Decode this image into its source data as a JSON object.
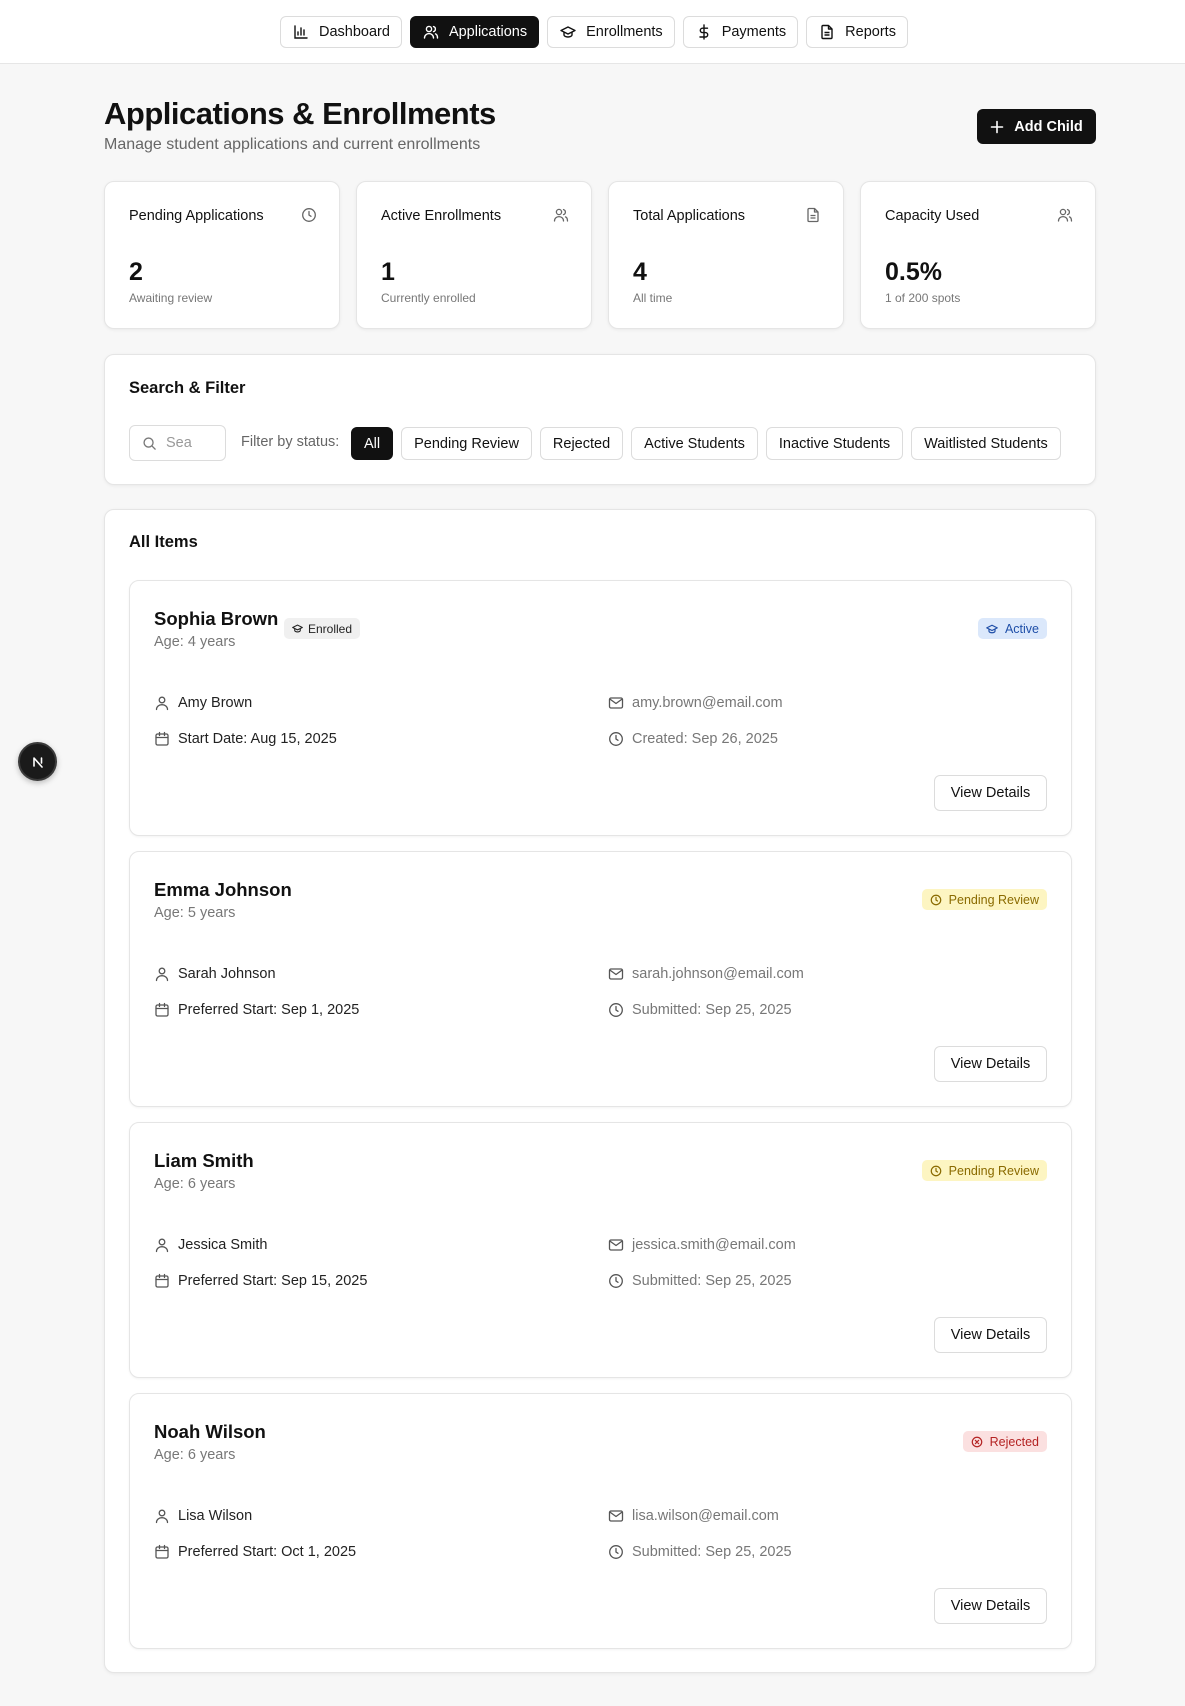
{
  "nav": {
    "tabs": [
      {
        "label": "Dashboard",
        "icon": "bar-chart-icon"
      },
      {
        "label": "Applications",
        "icon": "users-icon",
        "active": true
      },
      {
        "label": "Enrollments",
        "icon": "graduation-cap-icon"
      },
      {
        "label": "Payments",
        "icon": "dollar-icon"
      },
      {
        "label": "Reports",
        "icon": "file-text-icon"
      }
    ]
  },
  "header": {
    "title": "Applications & Enrollments",
    "subtitle": "Manage student applications and current enrollments",
    "add_button": "Add Child"
  },
  "stats": [
    {
      "label": "Pending Applications",
      "value": "2",
      "sub": "Awaiting review",
      "icon": "clock-icon"
    },
    {
      "label": "Active Enrollments",
      "value": "1",
      "sub": "Currently enrolled",
      "icon": "users-icon"
    },
    {
      "label": "Total Applications",
      "value": "4",
      "sub": "All time",
      "icon": "file-text-icon"
    },
    {
      "label": "Capacity Used",
      "value": "0.5%",
      "sub": "1 of 200 spots",
      "icon": "users-icon"
    }
  ],
  "filter": {
    "title": "Search & Filter",
    "search_placeholder": "Sea",
    "status_label": "Filter by status:",
    "chips": [
      "All",
      "Pending Review",
      "Rejected",
      "Active Students",
      "Inactive Students",
      "Waitlisted Students"
    ],
    "active_chip": "All"
  },
  "items": {
    "title": "All Items",
    "view_label": "View Details",
    "list": [
      {
        "name": "Sophia Brown",
        "age": "Age: 4 years",
        "badge": "Enrolled",
        "status": "Active",
        "status_type": "active",
        "parent": "Amy Brown",
        "email": "amy.brown@email.com",
        "date": "Start Date: Aug 15, 2025",
        "meta": "Created: Sep 26, 2025"
      },
      {
        "name": "Emma Johnson",
        "age": "Age: 5 years",
        "status": "Pending Review",
        "status_type": "pending",
        "parent": "Sarah Johnson",
        "email": "sarah.johnson@email.com",
        "date": "Preferred Start: Sep 1, 2025",
        "meta": "Submitted: Sep 25, 2025"
      },
      {
        "name": "Liam Smith",
        "age": "Age: 6 years",
        "status": "Pending Review",
        "status_type": "pending",
        "parent": "Jessica Smith",
        "email": "jessica.smith@email.com",
        "date": "Preferred Start: Sep 15, 2025",
        "meta": "Submitted: Sep 25, 2025"
      },
      {
        "name": "Noah Wilson",
        "age": "Age: 6 years",
        "status": "Rejected",
        "status_type": "rejected",
        "parent": "Lisa Wilson",
        "email": "lisa.wilson@email.com",
        "date": "Preferred Start: Oct 1, 2025",
        "meta": "Submitted: Sep 25, 2025"
      }
    ]
  },
  "floating_badge": {
    "label": "N",
    "icon": "nextjs-icon"
  },
  "colors": {
    "primary": "#111111",
    "active_badge_bg": "#dbe8fb",
    "pending_badge_bg": "#fdf5c2",
    "rejected_badge_bg": "#fbe0e0"
  }
}
